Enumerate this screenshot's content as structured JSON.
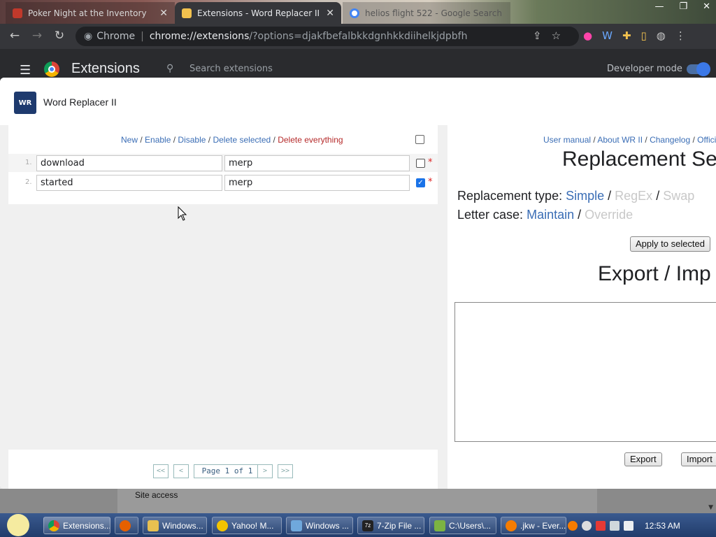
{
  "tabs": [
    {
      "title": "Poker Night at the Inventory",
      "close": "✕"
    },
    {
      "title": "Extensions - Word Replacer II",
      "close": "✕"
    },
    {
      "title": "helios flight 522 - Google Search"
    }
  ],
  "toolbar": {
    "site_label": "Chrome",
    "url_host": "chrome://extensions",
    "url_rest": "/?options=djakfbefalbkkdgnhkkdiihelkjdpbfh"
  },
  "extensions_header": {
    "title": "Extensions",
    "search_placeholder": "Search extensions",
    "dev_mode_label": "Developer mode"
  },
  "dialog": {
    "title": "Word Replacer II",
    "logo_text": "WR"
  },
  "list": {
    "actions": {
      "new": "New",
      "enable": "Enable",
      "disable": "Disable",
      "delete_selected": "Delete selected",
      "delete_everything": "Delete everything",
      "sep": " / "
    },
    "rows": [
      {
        "num": "1.",
        "find": "download",
        "replace": "merp",
        "checked": false,
        "star": "*"
      },
      {
        "num": "2.",
        "find": "started",
        "replace": "merp",
        "checked": true,
        "star": "*"
      }
    ]
  },
  "pager": {
    "first": "<<",
    "prev": "<",
    "info": "Page 1 of 1",
    "next": ">",
    "last": ">>"
  },
  "right_panel": {
    "links": {
      "manual": "User manual",
      "about": "About WR II",
      "changelog": "Changelog",
      "official": "Offici",
      "sep": " / "
    },
    "title": "Replacement Se",
    "type_label": "Replacement type:",
    "type_simple": "Simple",
    "type_regex": "RegEx",
    "type_swap": "Swap",
    "case_label": "Letter case:",
    "case_maintain": "Maintain",
    "case_override": "Override",
    "slash": " / ",
    "apply_button": "Apply to selected",
    "export_title": "Export / Imp",
    "export_button": "Export",
    "import_button": "Import"
  },
  "background": {
    "site_access": "Site access"
  },
  "taskbar": {
    "items": [
      {
        "label": "Extensions..."
      },
      {
        "label": ""
      },
      {
        "label": "Windows..."
      },
      {
        "label": "Yahoo! M..."
      },
      {
        "label": "Windows ..."
      },
      {
        "label": "7-Zip File ..."
      },
      {
        "label": "C:\\Users\\..."
      },
      {
        "label": ".jkw - Ever..."
      }
    ],
    "clock": "12:53 AM"
  },
  "colors": {
    "link_blue": "#3a6db5",
    "danger_red": "#b52a2a",
    "checkbox_blue": "#1a73e8"
  }
}
